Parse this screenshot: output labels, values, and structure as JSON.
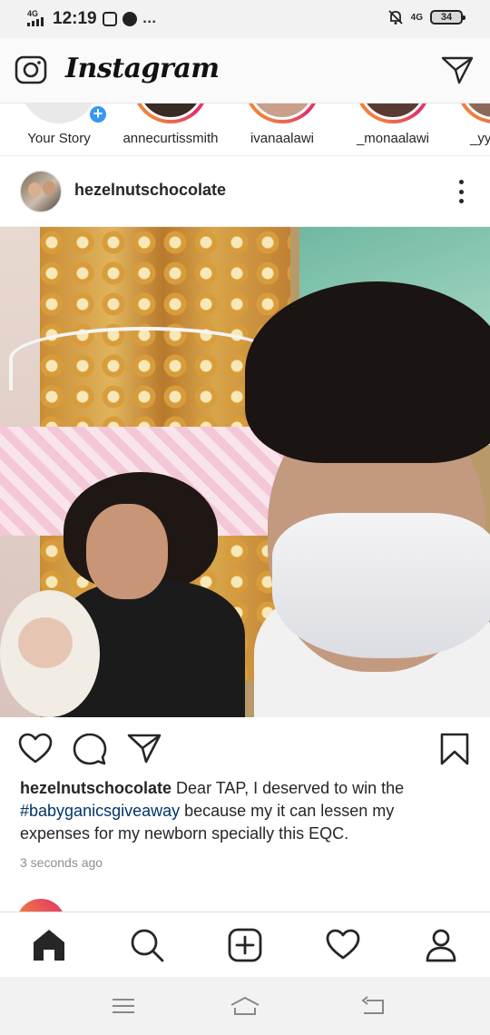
{
  "status_bar": {
    "network": "4G",
    "time": "12:19",
    "overflow": "…",
    "right_network": "4G",
    "battery": "34"
  },
  "header": {
    "logo": "Instagram",
    "camera_icon": "camera-icon",
    "dm_icon": "direct-message-icon"
  },
  "stories": [
    {
      "name": "Your Story",
      "ring": "none",
      "add": "+"
    },
    {
      "name": "annecurtissmith",
      "ring": "gradient"
    },
    {
      "name": "ivanaalawi",
      "ring": "gradient"
    },
    {
      "name": "_monaalawi",
      "ring": "gradient"
    },
    {
      "name": "_yy",
      "ring": "gradient"
    }
  ],
  "post": {
    "username": "hezelnutschocolate",
    "caption": {
      "user": "hezelnutschocolate",
      "text1": " Dear TAP, I deserved to win the ",
      "hashtag": "#babyganicsgiveaway",
      "text2": " because my it can lessen my expenses for my newborn specially this EQC."
    },
    "time_ago": "3 seconds ago"
  },
  "bottom_nav": [
    "home-icon",
    "search-icon",
    "add-post-icon",
    "activity-heart-icon",
    "profile-icon"
  ],
  "colors": {
    "link": "#003569",
    "story_badge": "#3897f0",
    "gradient_start": "#f9a825",
    "gradient_end": "#e1306c"
  }
}
